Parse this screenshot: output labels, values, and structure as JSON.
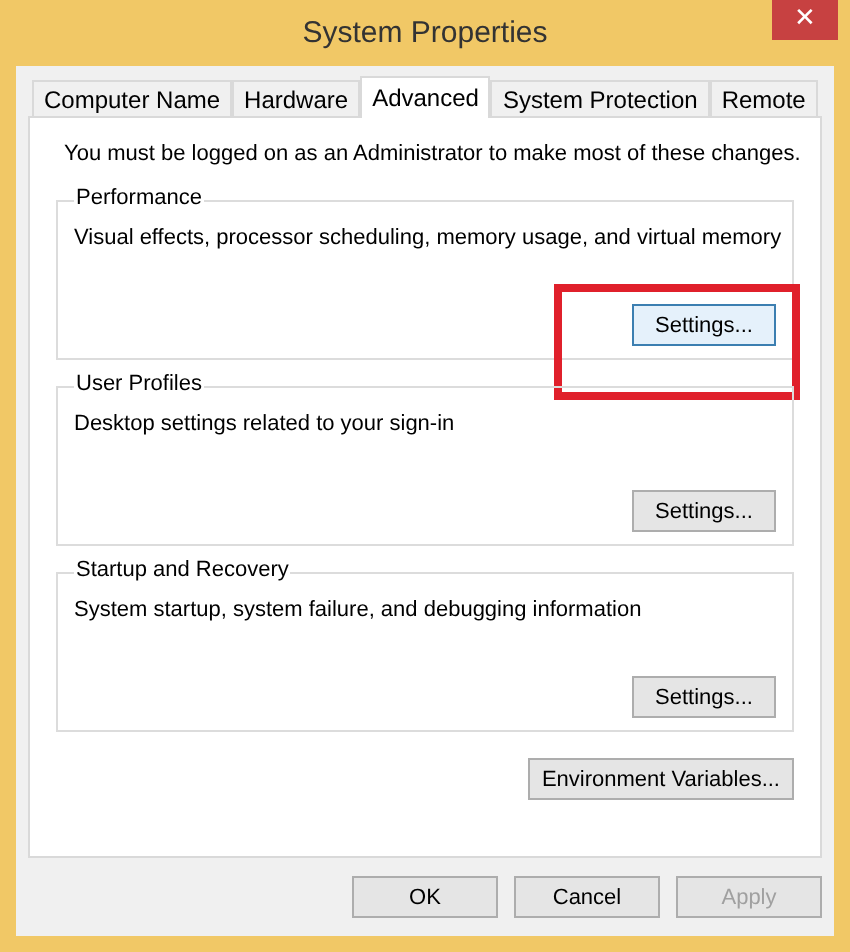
{
  "window": {
    "title": "System Properties",
    "close": "✕"
  },
  "tabs": [
    {
      "label": "Computer Name",
      "selected": false
    },
    {
      "label": "Hardware",
      "selected": false
    },
    {
      "label": "Advanced",
      "selected": true
    },
    {
      "label": "System Protection",
      "selected": false
    },
    {
      "label": "Remote",
      "selected": false
    }
  ],
  "notice": "You must be logged on as an Administrator to make most of these changes.",
  "groups": [
    {
      "title": "Performance",
      "description": "Visual effects, processor scheduling, memory usage, and virtual memory",
      "button": {
        "label": "Settings...",
        "focused": true,
        "highlighted": true
      }
    },
    {
      "title": "User Profiles",
      "description": "Desktop settings related to your sign-in",
      "button": {
        "label": "Settings...",
        "focused": false,
        "highlighted": false
      }
    },
    {
      "title": "Startup and Recovery",
      "description": "System startup, system failure, and debugging information",
      "button": {
        "label": "Settings...",
        "focused": false,
        "highlighted": false
      }
    }
  ],
  "environment_button": {
    "label": "Environment Variables..."
  },
  "buttons": [
    {
      "label": "OK",
      "disabled": false
    },
    {
      "label": "Cancel",
      "disabled": false
    },
    {
      "label": "Apply",
      "disabled": true
    }
  ]
}
